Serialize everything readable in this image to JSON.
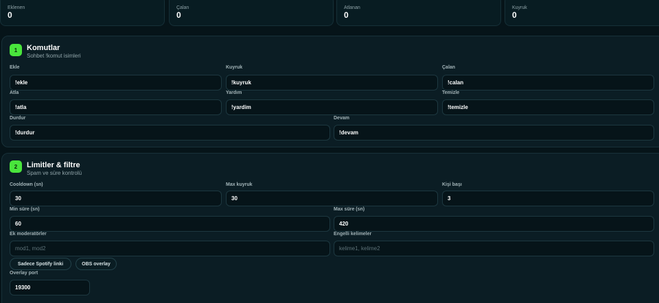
{
  "stats": [
    {
      "label": "Eklenen",
      "value": "0"
    },
    {
      "label": "Çalan",
      "value": "0"
    },
    {
      "label": "Atlanan",
      "value": "0"
    },
    {
      "label": "Kuyruk",
      "value": "0"
    }
  ],
  "commands": {
    "badge": "1",
    "title": "Komutlar",
    "subtitle": "Sohbet !komut isimleri",
    "fields": {
      "ekle": {
        "label": "Ekle",
        "value": "!ekle"
      },
      "kuyruk": {
        "label": "Kuyruk",
        "value": "!kuyruk"
      },
      "calan": {
        "label": "Çalan",
        "value": "!calan"
      },
      "atla": {
        "label": "Atla",
        "value": "!atla"
      },
      "yardim": {
        "label": "Yardım",
        "value": "!yardim"
      },
      "temizle": {
        "label": "Temizle",
        "value": "!temizle"
      },
      "durdur": {
        "label": "Durdur",
        "value": "!durdur"
      },
      "devam": {
        "label": "Devam",
        "value": "!devam"
      }
    }
  },
  "limits": {
    "badge": "2",
    "title": "Limitler & filtre",
    "subtitle": "Spam ve süre kontrolü",
    "fields": {
      "cooldown": {
        "label": "Cooldown (sn)",
        "value": "30"
      },
      "max_queue": {
        "label": "Max kuyruk",
        "value": "30"
      },
      "per_user": {
        "label": "Kişi başı",
        "value": "3"
      },
      "min_duration": {
        "label": "Min süre (sn)",
        "value": "60"
      },
      "max_duration": {
        "label": "Max süre (sn)",
        "value": "420"
      },
      "extra_mods": {
        "label": "Ek moderatörler",
        "placeholder": "mod1, mod2"
      },
      "banned_words": {
        "label": "Engelli kelimeler",
        "placeholder": "kelime1, kelime2"
      },
      "overlay_port": {
        "label": "Overlay port",
        "value": "19300"
      }
    },
    "toggles": {
      "spotify_only": "Sadece Spotify linki",
      "obs_overlay": "OBS overlay"
    }
  }
}
